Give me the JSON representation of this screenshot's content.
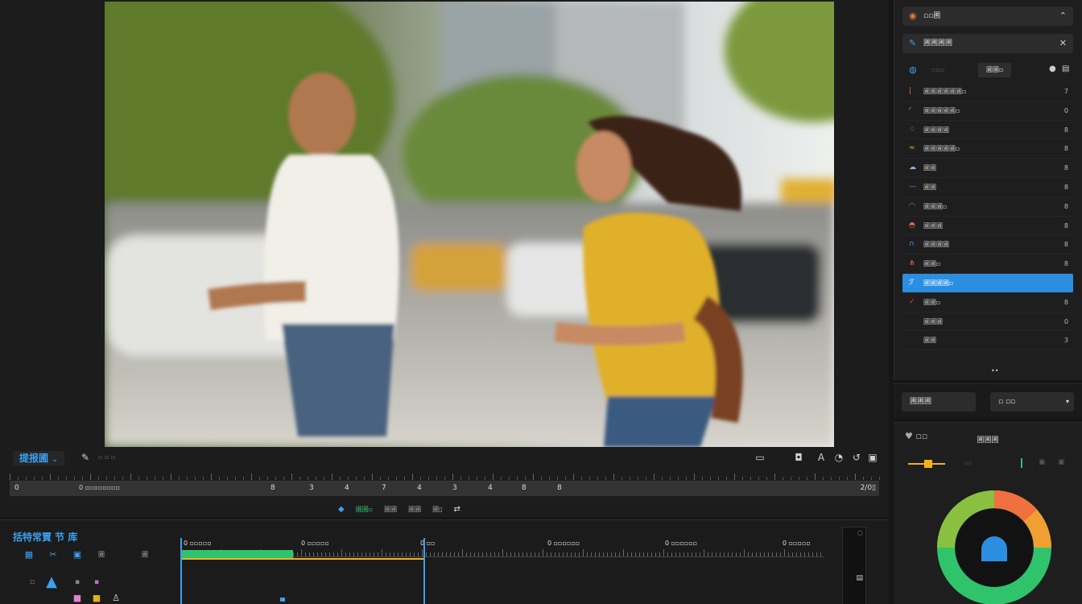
{
  "viewer": {
    "title": "提报圃",
    "title_chevron": "⌄",
    "subtitle": "▫ ▫ ▫",
    "scrub_start": "0",
    "timecode": "0 ▫▫▫▫▫▫▫▫",
    "scrub_numbers": [
      "8",
      "3",
      "4",
      "7",
      "4",
      "3",
      "4",
      "8",
      "8"
    ],
    "end_timecode": "2/0▯",
    "transport": [
      "圃圃▫",
      "圃圃",
      "圃圃",
      "圃▯"
    ]
  },
  "timeline": {
    "title": "括特常賈 节 库",
    "labels": [
      "0 ▫▫▫▫▫",
      "0 ▫▫▫▫▫",
      "0 ▫▫",
      "0 ▫▫▫▫▫▫",
      "0 ▫▫▫▫▫▫",
      "0 ▫▫▫▫▫"
    ],
    "tool_text": [
      "圃",
      "圃"
    ]
  },
  "right_panel": {
    "header1": "▫▫圃",
    "header2": "圃圃圃圃",
    "tabs": [
      "▫▫▫",
      "圃圃▫"
    ],
    "rows": [
      {
        "label": "圃圃圃圃圃圃▫",
        "value": "7",
        "icon": "pipe-icon"
      },
      {
        "label": "圃圃圃圃圃▫",
        "value": "0",
        "icon": "curve-icon"
      },
      {
        "label": "圃圃圃圃",
        "value": "8",
        "icon": "drop-icon"
      },
      {
        "label": "圃圃圃圃圃▫",
        "value": "8",
        "icon": "wave-icon"
      },
      {
        "label": "圃圃",
        "value": "8",
        "icon": "cloud-icon"
      },
      {
        "label": "圃圃",
        "value": "8",
        "icon": "line-icon"
      },
      {
        "label": "圃圃圃▫",
        "value": "8",
        "icon": "arc-icon"
      },
      {
        "label": "圃圃圃",
        "value": "8",
        "icon": "flame-icon"
      },
      {
        "label": "圃圃圃圃",
        "value": "8",
        "icon": "hook-icon"
      },
      {
        "label": "圃圃▫",
        "value": "8",
        "icon": "bars-icon"
      },
      {
        "label": "圃圃圃圃▫",
        "value": "",
        "icon": "fx-icon",
        "selected": true
      },
      {
        "label": "圃圃▫",
        "value": "8",
        "icon": "check-icon"
      },
      {
        "label": "圃圃圃",
        "value": "0",
        "icon": "blank-icon"
      },
      {
        "label": "圃圃",
        "value": "3",
        "icon": "blank-icon"
      }
    ],
    "pager": "••"
  },
  "panel2": {
    "box1": "圃圃圃",
    "box2": "▫ ▫▫"
  },
  "color_panel": {
    "title": "圃圃圃",
    "heart": "♥ ▫▫"
  },
  "colors": {
    "accent": "#2b8ee0",
    "green": "#2fc46c",
    "yellow": "#f0b020",
    "orange": "#f07040"
  }
}
